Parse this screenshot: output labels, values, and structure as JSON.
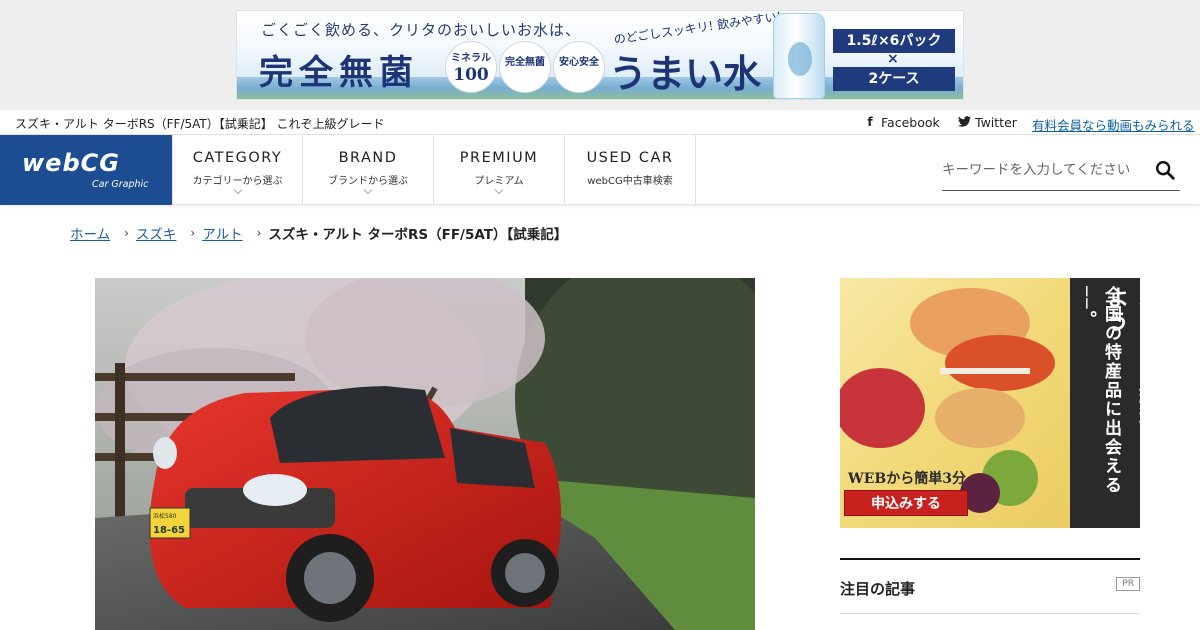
{
  "top_ad": {
    "tagline": "ごくごく飲める、クリタのおいしいお水は、",
    "headline": "完全無菌",
    "badge1_line1": "ミネラル",
    "badge1_number": "100",
    "badge2": "完全無菌",
    "badge3": "安心安全",
    "subcopy": "のどごしスッキリ! 飲みやすい!",
    "brand": "うまい水",
    "pack_line1": "1.5ℓ×6パック",
    "pack_times": "×",
    "pack_line2": "2ケース"
  },
  "info_bar": {
    "page_title": "スズキ・アルト ターボRS（FF/5AT）【試乗記】 これぞ上級グレード",
    "facebook_label": "Facebook",
    "twitter_label": "Twitter",
    "member_link": "有料会員なら動画もみられる"
  },
  "header": {
    "logo_text": "webCG",
    "logo_sub": "Car Graphic",
    "nav": [
      {
        "label": "CATEGORY",
        "desc": "カテゴリーから選ぶ"
      },
      {
        "label": "BRAND",
        "desc": "ブランドから選ぶ"
      },
      {
        "label": "PREMIUM",
        "desc": "プレミアム"
      },
      {
        "label": "USED CAR",
        "desc": "webCG中古車検索"
      }
    ],
    "search_placeholder": "キーワードを入力してください"
  },
  "breadcrumb": {
    "home": "ホーム",
    "maker": "スズキ",
    "model": "アルト",
    "current": "スズキ・アルト ターボRS（FF/5AT）【試乗記】"
  },
  "hero": {
    "plate_top": "浜松580",
    "plate_number": "18-65"
  },
  "side_ad": {
    "vertical_line1": "全国の特産品に出会える──。",
    "vertical_line2": "ふるさと納税をはじめよう",
    "catch": "WEBから簡単3分",
    "cta": "申込みする"
  },
  "sidebar": {
    "featured_heading": "注目の記事",
    "pr_label": "PR"
  },
  "colors": {
    "brand_blue": "#1c4d92",
    "link_blue": "#1a5aa0",
    "car_red": "#d0261f",
    "cta_red": "#c9211e"
  }
}
